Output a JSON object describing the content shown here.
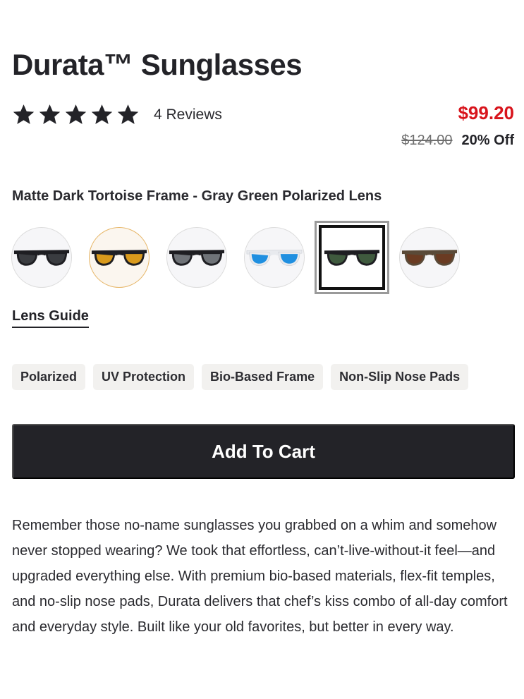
{
  "product": {
    "title": "Durata™ Sunglasses",
    "rating": 5,
    "rating_max": 5,
    "reviews_label": "4 Reviews",
    "price": "$99.20",
    "original_price": "$124.00",
    "discount": "20% Off"
  },
  "colors": {
    "price": "#d8141c",
    "button_bg": "#232328",
    "tag_bg": "#f2f1ef"
  },
  "variant": {
    "selected_label": "Matte Dark Tortoise Frame - Gray Green Polarized Lens",
    "swatches": [
      {
        "frame": "#1e1e22",
        "lens": "#3a3c40"
      },
      {
        "frame": "#1e1e22",
        "lens": "#d99a1c"
      },
      {
        "frame": "#1e1e22",
        "lens": "#6f7378"
      },
      {
        "frame": "#e8eaee",
        "lens": "#1f8fe0"
      },
      {
        "frame": "#1e1e22",
        "lens": "#3f5a3e"
      },
      {
        "frame": "#5a4a38",
        "lens": "#6a3b22"
      }
    ],
    "selected_index": 4
  },
  "lens_guide_label": "Lens Guide",
  "tags": [
    "Polarized",
    "UV Protection",
    "Bio-Based Frame",
    "Non-Slip Nose Pads"
  ],
  "cart": {
    "label": "Add To Cart"
  },
  "description": "Remember those no-name sunglasses you grabbed on a whim and somehow never stopped wearing? We took that effortless, can’t-live-without-it feel—and upgraded everything else. With premium bio-based materials, flex-fit temples, and no-slip nose pads, Durata delivers that chef’s kiss combo of all-day comfort and everyday style. Built like your old favorites, but better in every way.",
  "icons": {
    "star": "star-icon",
    "swatch": "sunglasses-icon"
  }
}
